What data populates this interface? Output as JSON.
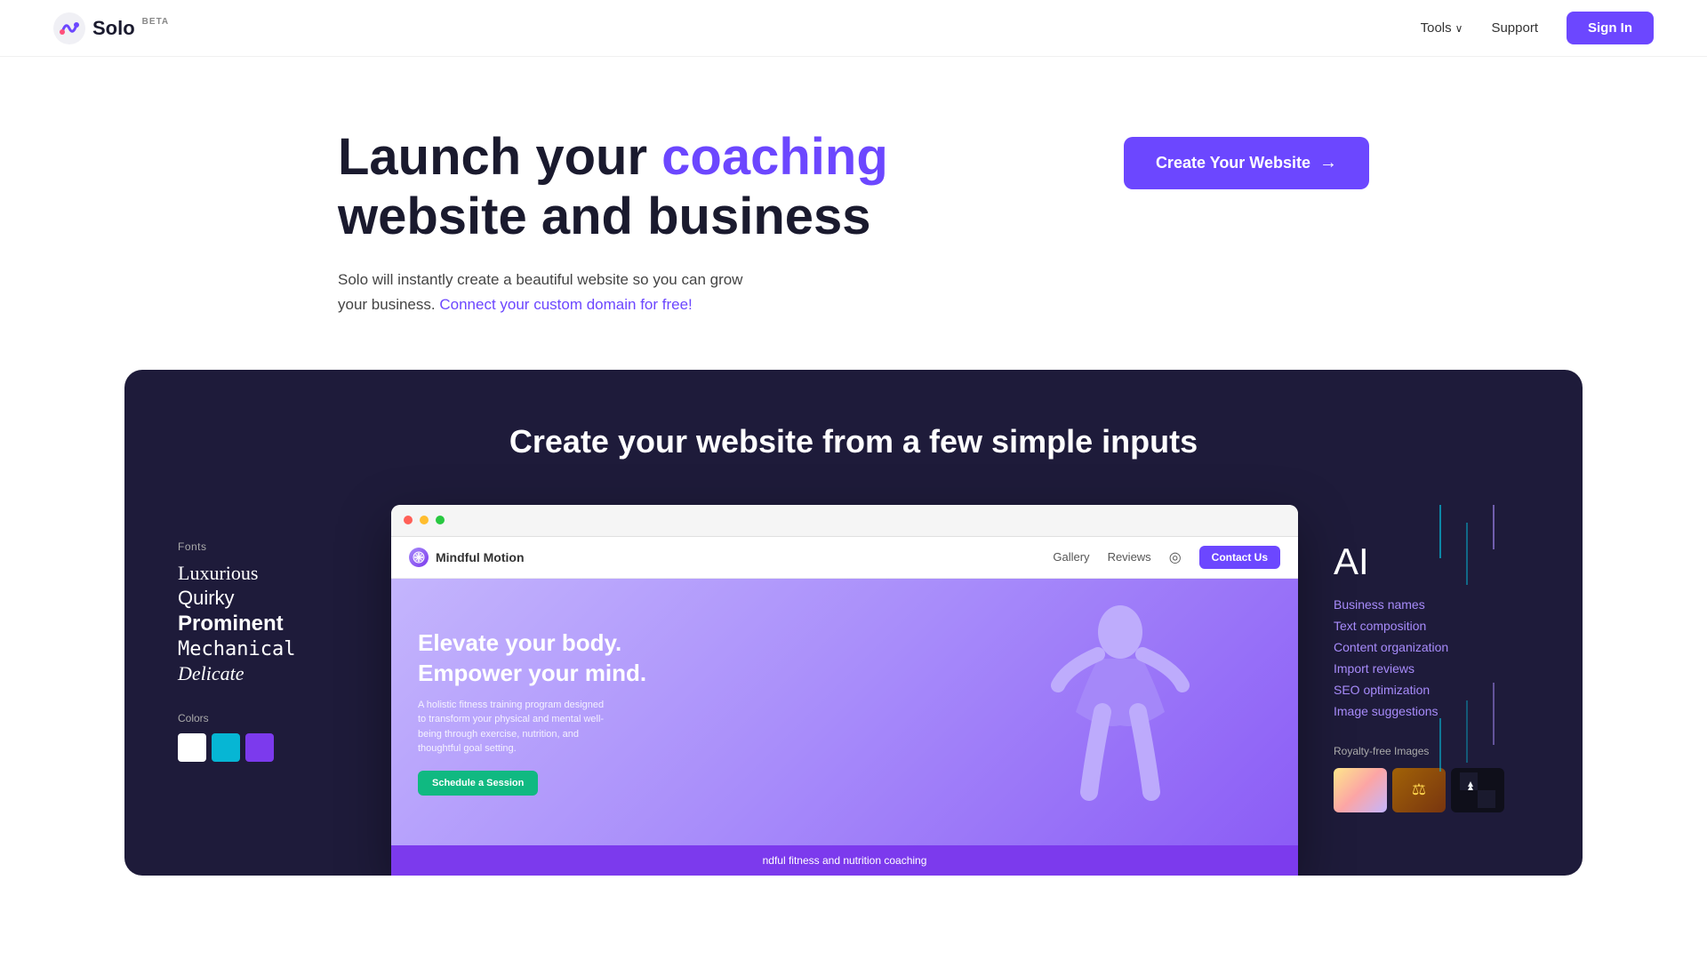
{
  "nav": {
    "logo_text": "Solo",
    "logo_beta": "BETA",
    "tools_label": "Tools",
    "support_label": "Support",
    "signin_label": "Sign In"
  },
  "hero": {
    "title_part1": "Launch your ",
    "title_accent": "coaching",
    "title_part2": "website and business",
    "subtitle": "Solo will instantly create a beautiful website so you can grow your business.",
    "subtitle_link": "Connect your custom domain for free!",
    "cta_label": "Create Your Website",
    "cta_arrow": "→"
  },
  "dark_section": {
    "title": "Create your website from a few simple inputs",
    "fonts_label": "Fonts",
    "font_luxurious": "Luxurious",
    "font_quirky": "Quirky",
    "font_prominent": "Prominent",
    "font_mechanical": "Mechanical",
    "font_delicate": "Delicate",
    "colors_label": "Colors",
    "browser": {
      "brand_name": "Mindful Motion",
      "nav_gallery": "Gallery",
      "nav_reviews": "Reviews",
      "nav_contact": "Contact Us",
      "hero_h1_line1": "Elevate your body.",
      "hero_h1_line2": "Empower your mind.",
      "hero_p": "A holistic fitness training program designed to transform your physical and mental well-being through exercise, nutrition, and thoughtful goal setting.",
      "schedule_btn": "Schedule a Session",
      "footer_text": "ndful fitness and nutrition coaching"
    },
    "ai": {
      "label": "AI",
      "feature1": "Business names",
      "feature2": "Text composition",
      "feature3": "Content organization",
      "feature4": "Import reviews",
      "feature5": "SEO optimization",
      "feature6": "Image suggestions",
      "royalty_label": "Royalty-free Images"
    }
  }
}
